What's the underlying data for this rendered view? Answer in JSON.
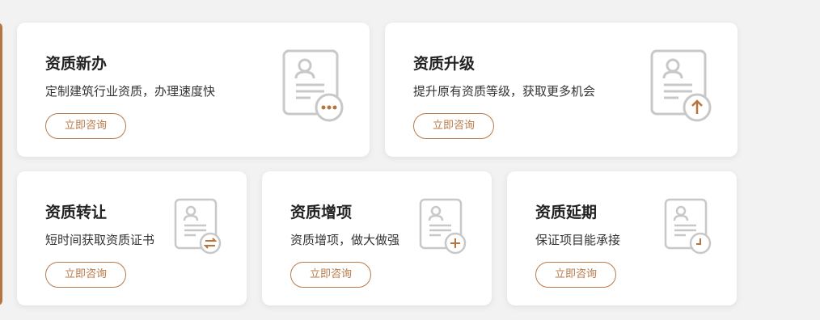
{
  "colors": {
    "accent": "#b8743f",
    "button_border": "#b87a4a",
    "icon_gray": "#c8c8c8",
    "background": "#f2f2f2"
  },
  "cards": [
    {
      "title": "资质新办",
      "desc": "定制建筑行业资质，办理速度快",
      "button": "立即咨询",
      "badge_icon": "more-dots-icon"
    },
    {
      "title": "资质升级",
      "desc": "提升原有资质等级，获取更多机会",
      "button": "立即咨询",
      "badge_icon": "arrow-up-icon"
    },
    {
      "title": "资质转让",
      "desc": "短时间获取资质证书",
      "button": "立即咨询",
      "badge_icon": "swap-arrows-icon"
    },
    {
      "title": "资质增项",
      "desc": "资质增项，做大做强",
      "button": "立即咨询",
      "badge_icon": "plus-icon"
    },
    {
      "title": "资质延期",
      "desc": "保证项目能承接",
      "button": "立即咨询",
      "badge_icon": "clock-icon"
    }
  ]
}
